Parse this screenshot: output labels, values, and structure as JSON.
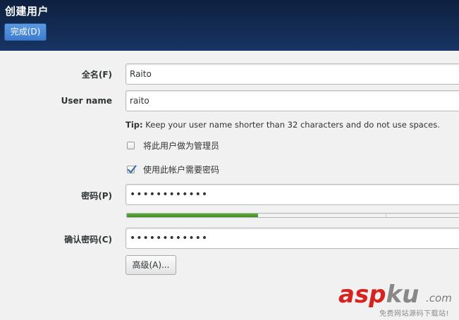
{
  "header": {
    "title": "创建用户",
    "done_label": "完成(D)",
    "accent_color": "#4a8ad8"
  },
  "form": {
    "fullname": {
      "label": "全名(F)",
      "value": "Raito"
    },
    "username": {
      "label": "User name",
      "value": "raito"
    },
    "tip": {
      "prefix": "Tip:",
      "text": " Keep your user name shorter than 32 characters and do not use spaces."
    },
    "admin_checkbox": {
      "label": "将此用户做为管理员",
      "checked": false
    },
    "password_required_checkbox": {
      "label": "使用此帐户需要密码",
      "checked": true
    },
    "password": {
      "label": "密码(P)",
      "value": "••••••••••••"
    },
    "strength": {
      "level": 0.39,
      "color": "#4e9a2a"
    },
    "confirm": {
      "label": "确认密码(C)",
      "value": "••••••••••••"
    },
    "advanced_label": "高级(A)..."
  },
  "watermark": {
    "brand_red": "asp",
    "brand_gray": "ku",
    "domain": ".com",
    "tagline": "免费网站源码下载站!"
  }
}
